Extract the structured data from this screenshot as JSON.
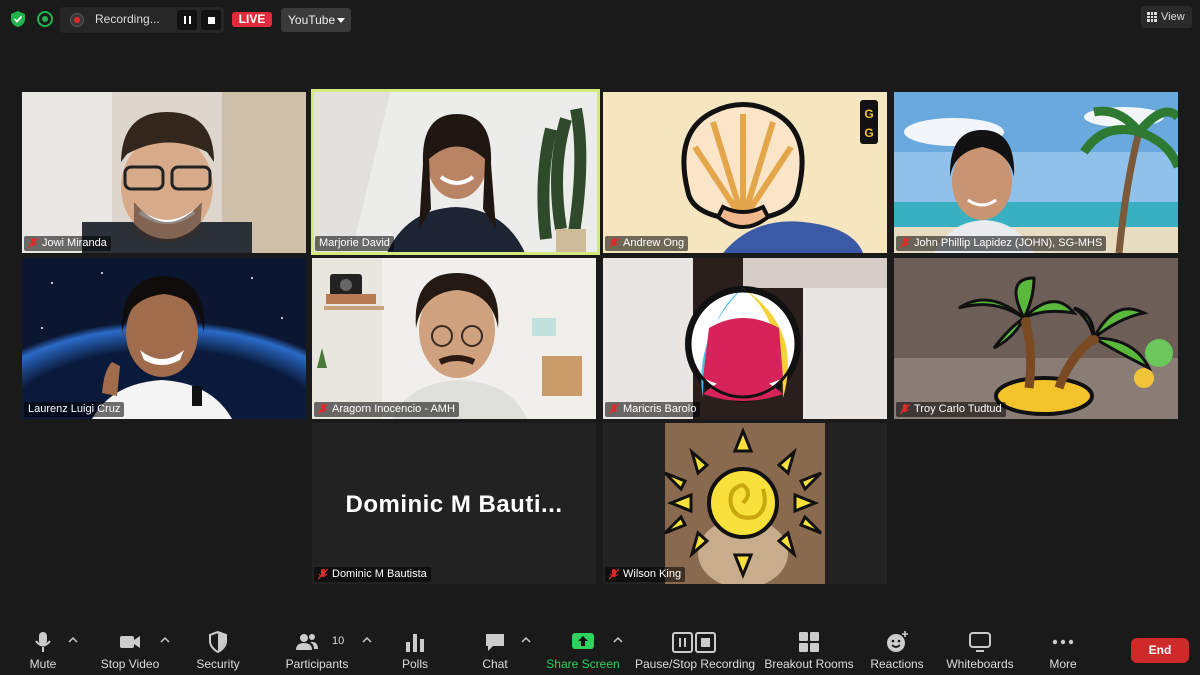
{
  "meeting": {
    "recording": {
      "status_text": "Recording...",
      "live_label": "LIVE",
      "stream_target": "YouTube"
    },
    "view_label": "View",
    "participants": [
      {
        "name": "Jowi Miranda",
        "muted": true,
        "video": "camera"
      },
      {
        "name": "Marjorie David",
        "muted": false,
        "video": "camera",
        "active_speaker": true
      },
      {
        "name": "Andrew Ong",
        "muted": true,
        "video": "camera",
        "sticker": "shell"
      },
      {
        "name": "John Phillip Lapidez (JOHN), SG-MHS",
        "muted": true,
        "video": "camera"
      },
      {
        "name": "Laurenz Luigi Cruz",
        "muted": false,
        "video": "camera"
      },
      {
        "name": "Aragorn Inocencio - AMH",
        "muted": true,
        "video": "camera"
      },
      {
        "name": "Maricris Barolo",
        "muted": true,
        "video": "camera",
        "sticker": "beach-ball"
      },
      {
        "name": "Troy Carlo Tudtud",
        "muted": true,
        "video": "camera",
        "sticker": "palm-island"
      },
      {
        "name": "Dominic M Bautista",
        "display_text": "Dominic M Bauti...",
        "muted": true,
        "video": "off"
      },
      {
        "name": "Wilson King",
        "muted": true,
        "video": "camera",
        "sticker": "sun"
      }
    ]
  },
  "toolbar": {
    "mute": "Mute",
    "stop_video": "Stop Video",
    "security": "Security",
    "participants": "Participants",
    "participants_count": "10",
    "polls": "Polls",
    "chat": "Chat",
    "share_screen": "Share Screen",
    "pause_stop_recording": "Pause/Stop Recording",
    "breakout_rooms": "Breakout Rooms",
    "reactions": "Reactions",
    "whiteboards": "Whiteboards",
    "more": "More",
    "end": "End"
  },
  "colors": {
    "accent_green": "#2fd25c",
    "live_red": "#e02b3c",
    "end_red": "#cf2a2a",
    "active_speaker_border": "#d4ea7c"
  }
}
